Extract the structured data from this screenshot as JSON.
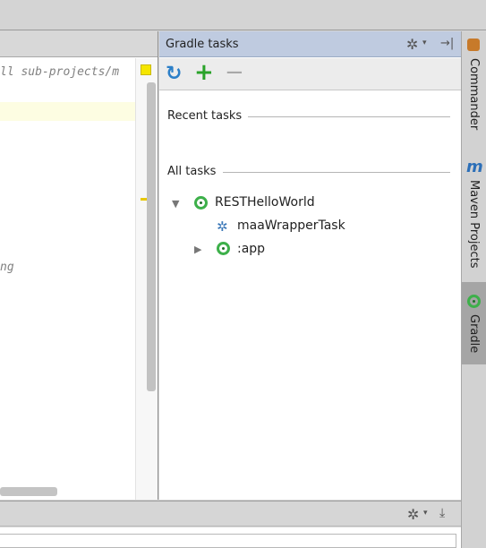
{
  "editor": {
    "code_line1": "ll sub-projects/m",
    "code_line2": "ng"
  },
  "gradle_panel": {
    "title": "Gradle tasks",
    "toolbar": {
      "refresh_icon": "refresh-icon",
      "add_icon": "add-icon",
      "remove_icon": "remove-icon"
    },
    "sections": {
      "recent": "Recent tasks",
      "all": "All tasks"
    },
    "tree": {
      "root": "RESTHelloWorld",
      "task": "maaWrapperTask",
      "app": ":app"
    }
  },
  "right_strip": {
    "tabs": [
      {
        "label": "Commander",
        "icon": "commander-icon"
      },
      {
        "label": "Maven Projects",
        "icon": "maven-icon"
      },
      {
        "label": "Gradle",
        "icon": "gradle-icon",
        "active": true
      }
    ]
  },
  "colors": {
    "gradle_header_bg": "#bfcbe0",
    "gradle_green": "#3db04a",
    "refresh_blue": "#2c7fc8",
    "add_green": "#2aa32a",
    "editor_highlight": "#fdfde2",
    "warning_yellow": "#f5e600"
  }
}
